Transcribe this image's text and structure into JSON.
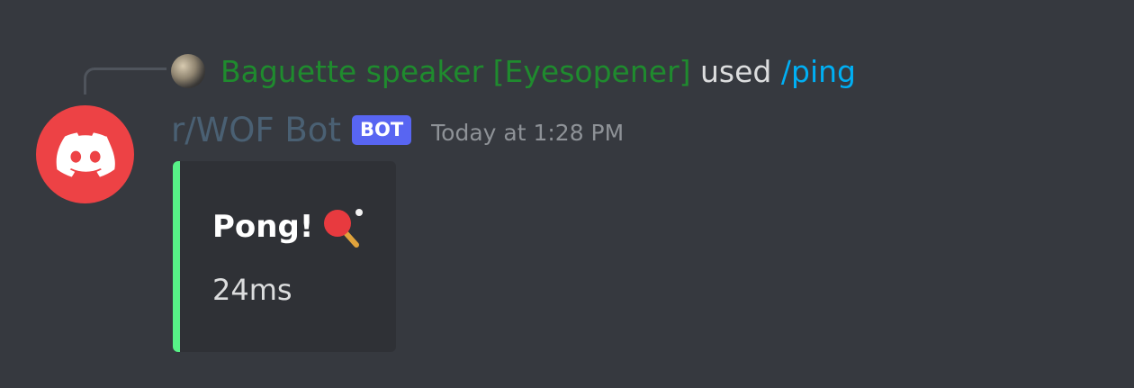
{
  "reply": {
    "username": "Baguette speaker [Eyesopener]",
    "action": "used",
    "command": "/ping"
  },
  "message": {
    "author": "r/WOF Bot",
    "badge": "BOT",
    "timestamp": "Today at 1:28 PM",
    "avatar_icon": "discord-logo-icon"
  },
  "embed": {
    "title": "Pong!",
    "title_icon": "ping-pong-icon",
    "description": "24ms",
    "accent_color": "#57f287"
  },
  "colors": {
    "background": "#36393f",
    "embed_background": "#2f3136",
    "avatar_background": "#ed4245",
    "bot_badge": "#5865f2",
    "command_link": "#00aff4",
    "reply_username": "#1f8b2e"
  }
}
